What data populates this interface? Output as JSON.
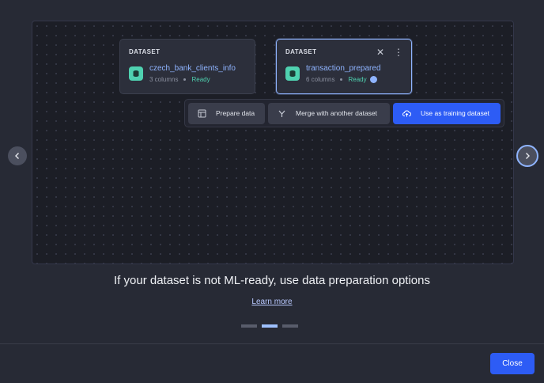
{
  "cards": [
    {
      "type": "DATASET",
      "name": "czech_bank_clients_info",
      "columns": "3 columns",
      "status": "Ready",
      "icon": "database-icon"
    },
    {
      "type": "DATASET",
      "name": "transaction_prepared",
      "columns": "6 columns",
      "status": "Ready",
      "icon": "database-icon",
      "actions": {
        "close": "✕",
        "more": "⋮"
      }
    }
  ],
  "toolbar": {
    "prepare_label": "Prepare data",
    "merge_label": "Merge with another dataset",
    "train_label": "Use as training dataset"
  },
  "headline": "If your dataset is not ML-ready, use data preparation options",
  "learn_more": "Learn more",
  "pagination": {
    "current": 2,
    "total": 3
  },
  "close_label": "Close",
  "colors": {
    "accent": "#2d5cf5",
    "link": "#8fb4ff",
    "ready": "#4fd1b0"
  }
}
